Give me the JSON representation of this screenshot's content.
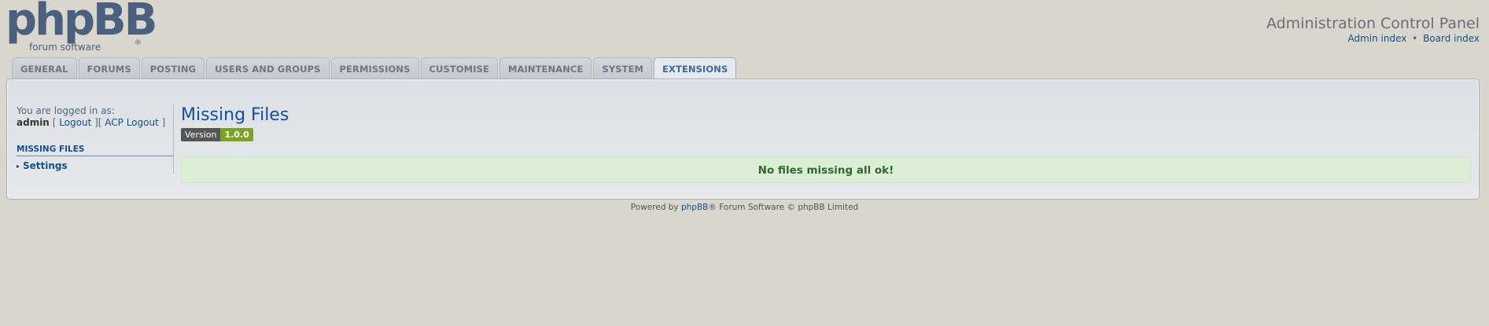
{
  "logo": {
    "big": "phpBB",
    "small": "forum  software",
    "reg": "®"
  },
  "header": {
    "title": "Administration Control Panel",
    "links": {
      "admin_index": "Admin index",
      "separator": "•",
      "board_index": "Board index"
    }
  },
  "tabs": [
    {
      "label": "GENERAL"
    },
    {
      "label": "FORUMS"
    },
    {
      "label": "POSTING"
    },
    {
      "label": "USERS AND GROUPS"
    },
    {
      "label": "PERMISSIONS"
    },
    {
      "label": "CUSTOMISE"
    },
    {
      "label": "MAINTENANCE"
    },
    {
      "label": "SYSTEM"
    },
    {
      "label": "EXTENSIONS",
      "active": true
    }
  ],
  "sidebar": {
    "logged_in_text": "You are logged in as:",
    "username": "admin",
    "logout": "Logout",
    "acp_logout": "ACP Logout",
    "menu_heading": "MISSING FILES",
    "menu_items": [
      {
        "label": "Settings"
      }
    ]
  },
  "main": {
    "title": "Missing Files",
    "version_label": "Version",
    "version_value": "1.0.0",
    "message": "No files missing all ok!"
  },
  "footer": {
    "powered_by": "Powered by ",
    "phpbb_link": "phpBB",
    "rest": "® Forum Software © phpBB Limited"
  },
  "colors": {
    "background": "#d9d6cd",
    "link": "#105289",
    "success_bg": "#dcefd6",
    "success_text": "#2d6a2b"
  }
}
